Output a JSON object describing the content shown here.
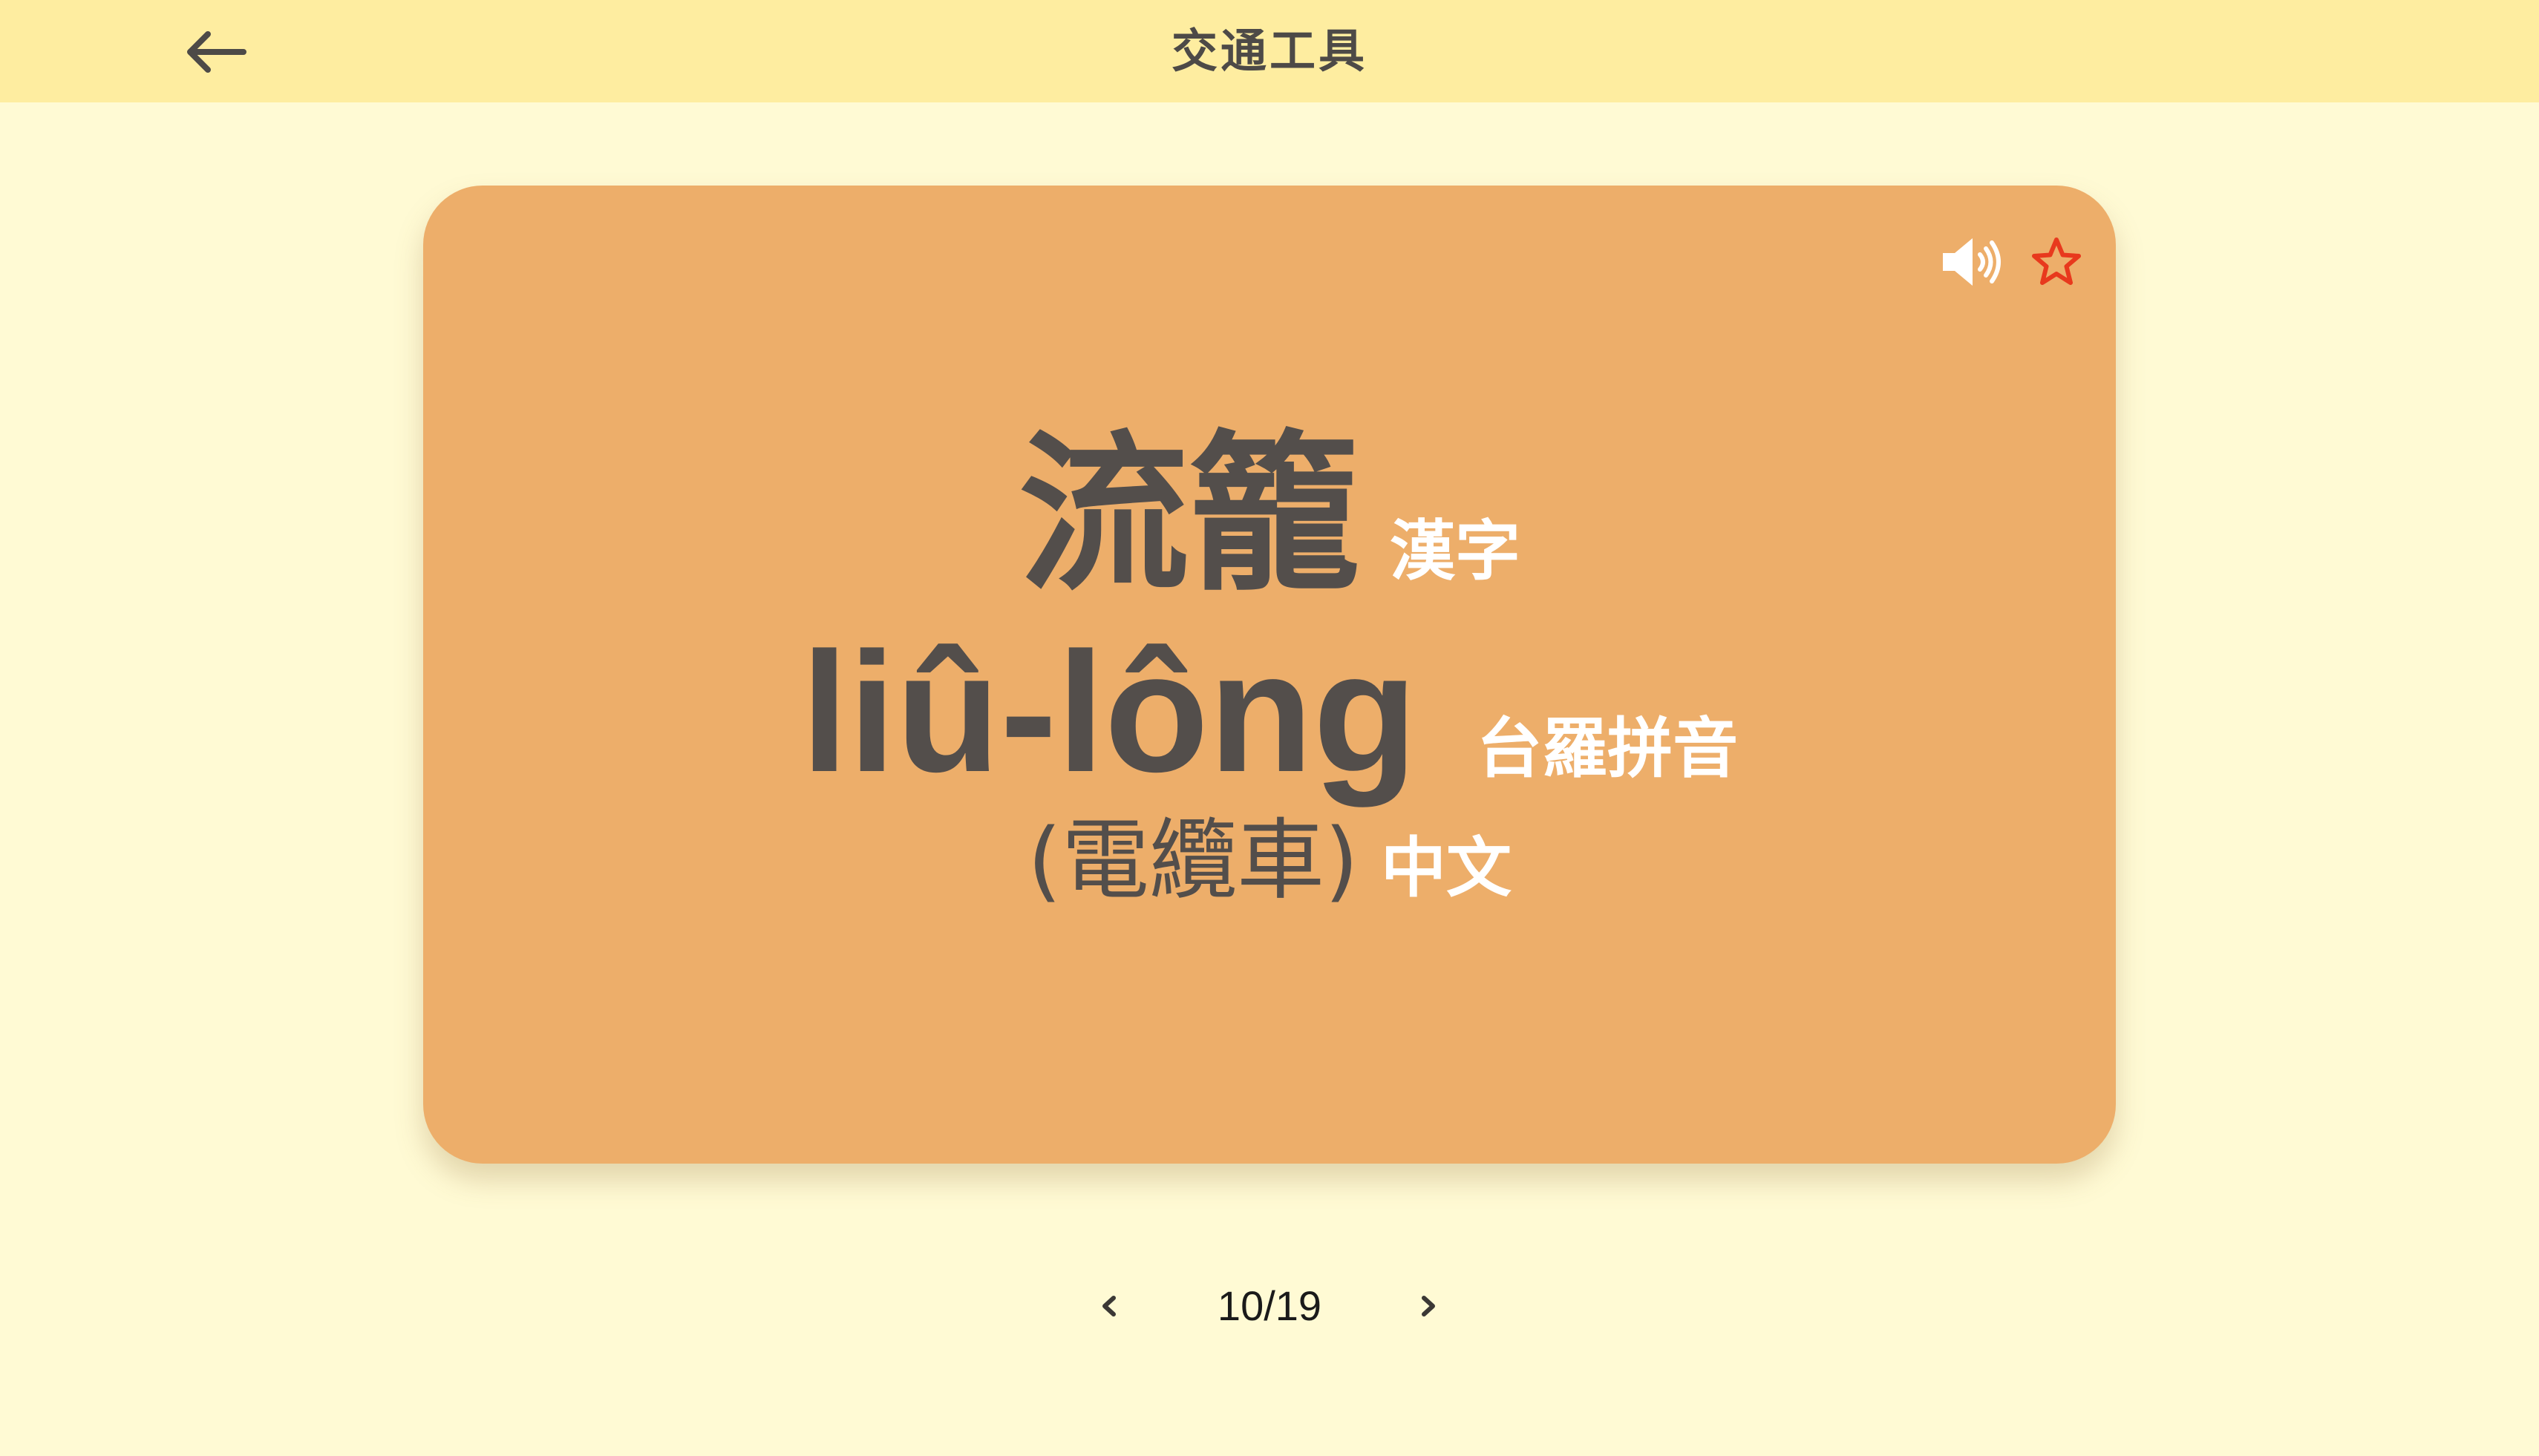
{
  "header": {
    "title": "交通工具",
    "back_icon": "arrow-left-icon"
  },
  "card": {
    "hanji": "流籠",
    "hanji_tag": "漢字",
    "lomaji": "liû-lông",
    "lomaji_tag": "台羅拼音",
    "chinese": "(電纜車)",
    "chinese_tag": "中文",
    "speaker_icon": "speaker-icon",
    "favorite_icon": "star-outline-icon",
    "accent_color": "#edae6a",
    "favorite_color": "#e8391d"
  },
  "pager": {
    "current": "10/19",
    "prev_icon": "chevron-left-icon",
    "next_icon": "chevron-right-icon"
  }
}
